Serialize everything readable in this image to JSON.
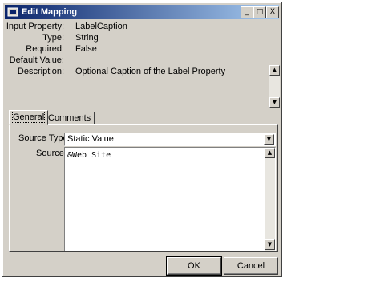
{
  "window": {
    "title": "Edit Mapping",
    "controls": {
      "minimize": "_",
      "maximize": "□",
      "close": "X"
    }
  },
  "properties": [
    {
      "label": "Input Property:",
      "value": "LabelCaption"
    },
    {
      "label": "Type:",
      "value": "String"
    },
    {
      "label": "Required:",
      "value": "False"
    },
    {
      "label": "Default Value:",
      "value": ""
    },
    {
      "label": "Description:",
      "value": "Optional Caption of the Label Property"
    }
  ],
  "tabs": [
    {
      "label": "General",
      "active": true
    },
    {
      "label": "Comments",
      "active": false
    }
  ],
  "form": {
    "source_type_label": "Source Type",
    "source_type_value": "Static Value",
    "source_label": "Source",
    "source_value": "&Web Site"
  },
  "buttons": {
    "ok": "OK",
    "cancel": "Cancel"
  },
  "icons": {
    "scroll_up": "▲",
    "scroll_down": "▼",
    "dropdown": "▼"
  },
  "colors": {
    "title_start": "#0a246a",
    "title_end": "#a6caf0",
    "face": "#d4d0c8"
  }
}
